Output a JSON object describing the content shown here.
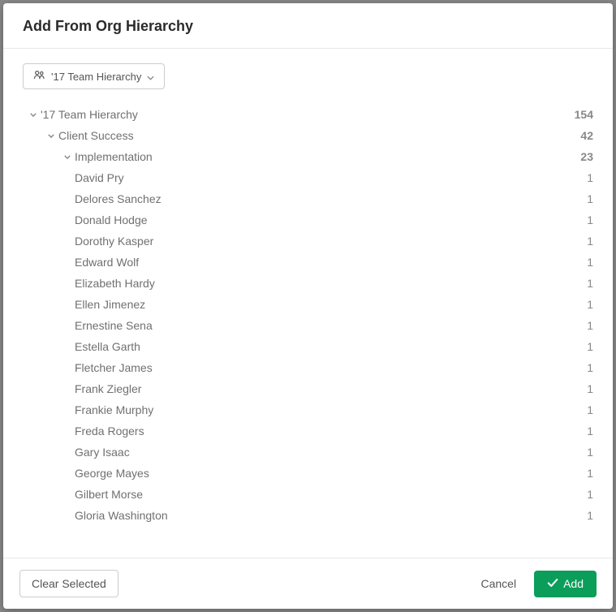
{
  "modal": {
    "title": "Add From Org Hierarchy"
  },
  "dropdown": {
    "label": "'17 Team Hierarchy"
  },
  "tree": {
    "root": {
      "label": "'17 Team Hierarchy",
      "count": "154"
    },
    "level1": {
      "label": "Client Success",
      "count": "42"
    },
    "level2": {
      "label": "Implementation",
      "count": "23"
    },
    "members": [
      {
        "label": "David Pry",
        "count": "1"
      },
      {
        "label": "Delores Sanchez",
        "count": "1"
      },
      {
        "label": "Donald Hodge",
        "count": "1"
      },
      {
        "label": "Dorothy Kasper",
        "count": "1"
      },
      {
        "label": "Edward Wolf",
        "count": "1"
      },
      {
        "label": "Elizabeth Hardy",
        "count": "1"
      },
      {
        "label": "Ellen Jimenez",
        "count": "1"
      },
      {
        "label": "Ernestine Sena",
        "count": "1"
      },
      {
        "label": "Estella Garth",
        "count": "1"
      },
      {
        "label": "Fletcher James",
        "count": "1"
      },
      {
        "label": "Frank Ziegler",
        "count": "1"
      },
      {
        "label": "Frankie Murphy",
        "count": "1"
      },
      {
        "label": "Freda Rogers",
        "count": "1"
      },
      {
        "label": "Gary Isaac",
        "count": "1"
      },
      {
        "label": "George Mayes",
        "count": "1"
      },
      {
        "label": "Gilbert Morse",
        "count": "1"
      },
      {
        "label": "Gloria Washington",
        "count": "1"
      }
    ]
  },
  "footer": {
    "clear": "Clear Selected",
    "cancel": "Cancel",
    "add": "Add"
  }
}
